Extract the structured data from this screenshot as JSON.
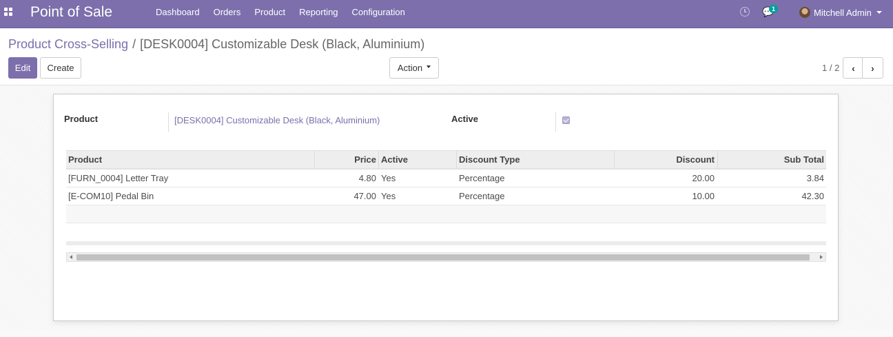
{
  "navbar": {
    "app_title": "Point of Sale",
    "menu": [
      "Dashboard",
      "Orders",
      "Product",
      "Reporting",
      "Configuration"
    ],
    "chat_badge": "1",
    "user_name": "Mitchell Admin",
    "icons": {
      "apps": "apps-grid-icon",
      "activity": "clock-icon",
      "messages": "chat-bubbles-icon"
    },
    "color": "#7c6fac"
  },
  "breadcrumb": {
    "parent": "Product Cross-Selling",
    "separator": "/",
    "current": "[DESK0004] Customizable Desk (Black, Aluminium)"
  },
  "buttons": {
    "edit": "Edit",
    "create": "Create",
    "action": "Action"
  },
  "pager": {
    "value": "1 / 2",
    "prev_icon": "chevron-left-icon",
    "next_icon": "chevron-right-icon"
  },
  "form": {
    "product_label": "Product",
    "product_value": "[DESK0004] Customizable Desk (Black, Aluminium)",
    "active_label": "Active",
    "active_checked": true
  },
  "table": {
    "columns": [
      "Product",
      "Price",
      "Active",
      "Discount Type",
      "Discount",
      "Sub Total"
    ],
    "rows": [
      {
        "product": "[FURN_0004] Letter Tray",
        "price": "4.80",
        "active": "Yes",
        "discount_type": "Percentage",
        "discount": "20.00",
        "sub_total": "3.84"
      },
      {
        "product": "[E-COM10] Pedal Bin",
        "price": "47.00",
        "active": "Yes",
        "discount_type": "Percentage",
        "discount": "10.00",
        "sub_total": "42.30"
      }
    ]
  }
}
